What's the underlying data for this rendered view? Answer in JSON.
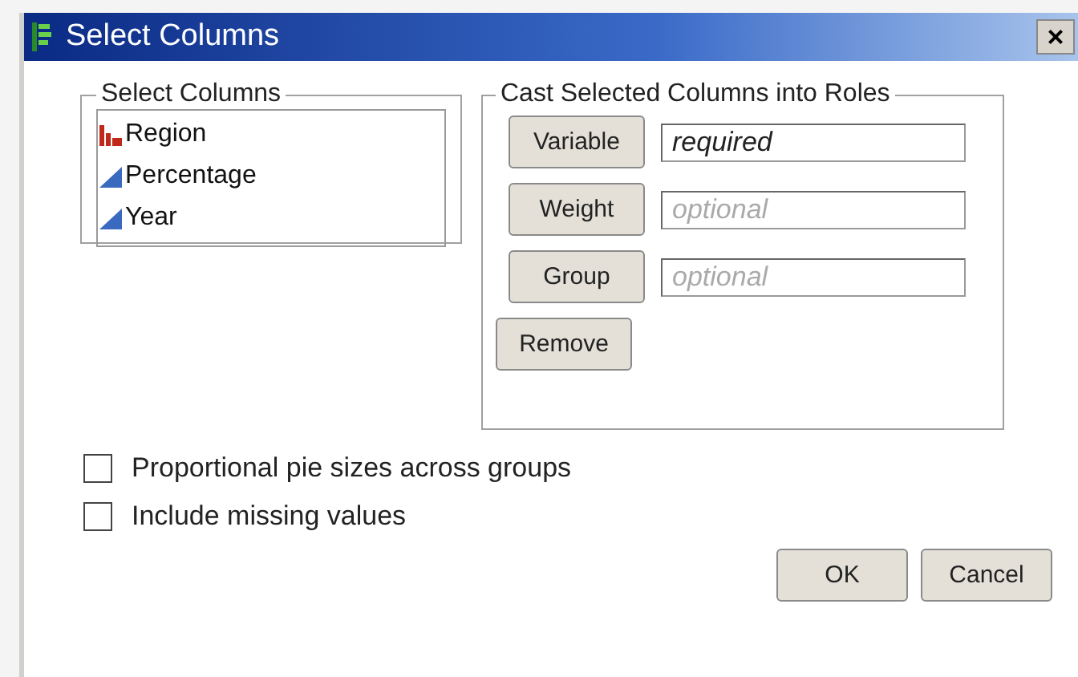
{
  "window": {
    "title": "Select Columns",
    "close": "×"
  },
  "select_columns": {
    "title": "Select Columns",
    "items": [
      {
        "label": "Region",
        "kind": "nominal"
      },
      {
        "label": "Percentage",
        "kind": "continuous"
      },
      {
        "label": "Year",
        "kind": "continuous"
      }
    ]
  },
  "roles": {
    "title": "Cast Selected Columns into Roles",
    "rows": [
      {
        "button": "Variable",
        "value": "required"
      },
      {
        "button": "Weight",
        "placeholder": "optional"
      },
      {
        "button": "Group",
        "placeholder": "optional"
      }
    ],
    "remove": "Remove"
  },
  "options": [
    {
      "label": "Proportional pie sizes across groups",
      "checked": false
    },
    {
      "label": "Include missing values",
      "checked": false
    }
  ],
  "buttons": [
    "OK",
    "Cancel"
  ]
}
